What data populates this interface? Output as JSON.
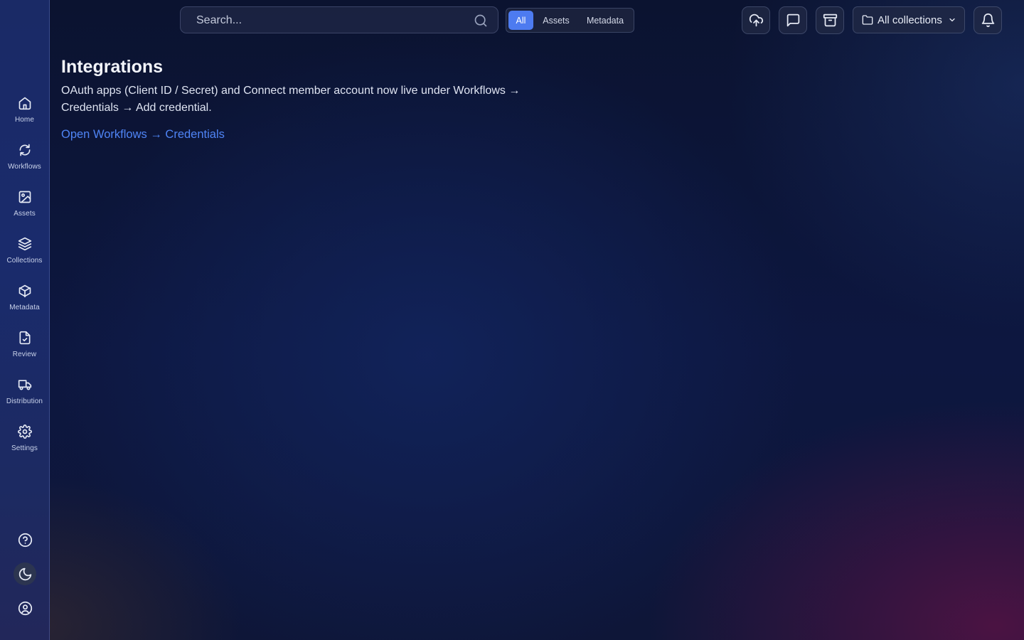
{
  "colors": {
    "accent": "#4d7bf0",
    "link": "#4f84f5",
    "sidebar_bg": "#1a2b6c",
    "page_bg": "#0d1740"
  },
  "sidebar": {
    "items": [
      {
        "label": "Home",
        "icon": "home-icon"
      },
      {
        "label": "Workflows",
        "icon": "refresh-icon"
      },
      {
        "label": "Assets",
        "icon": "image-icon"
      },
      {
        "label": "Collections",
        "icon": "layers-icon"
      },
      {
        "label": "Metadata",
        "icon": "box-icon"
      },
      {
        "label": "Review",
        "icon": "file-check-icon"
      },
      {
        "label": "Distribution",
        "icon": "truck-icon"
      },
      {
        "label": "Settings",
        "icon": "gear-icon"
      }
    ],
    "bottom": [
      {
        "icon": "help-icon"
      },
      {
        "icon": "moon-icon"
      },
      {
        "icon": "user-circle-icon"
      }
    ]
  },
  "search": {
    "placeholder": "Search..."
  },
  "scope": {
    "options": [
      "All",
      "Assets",
      "Metadata"
    ],
    "selected": "All"
  },
  "toolbar": {
    "icons": [
      "upload-cloud-icon",
      "message-icon",
      "archive-icon",
      "bell-icon"
    ],
    "collections_label": "All collections"
  },
  "main": {
    "title": "Integrations",
    "description": "OAuth apps (Client ID / Secret) and Connect member account now live under Workflows → Credentials → Add credential.",
    "link_label": "Open Workflows → Credentials"
  }
}
